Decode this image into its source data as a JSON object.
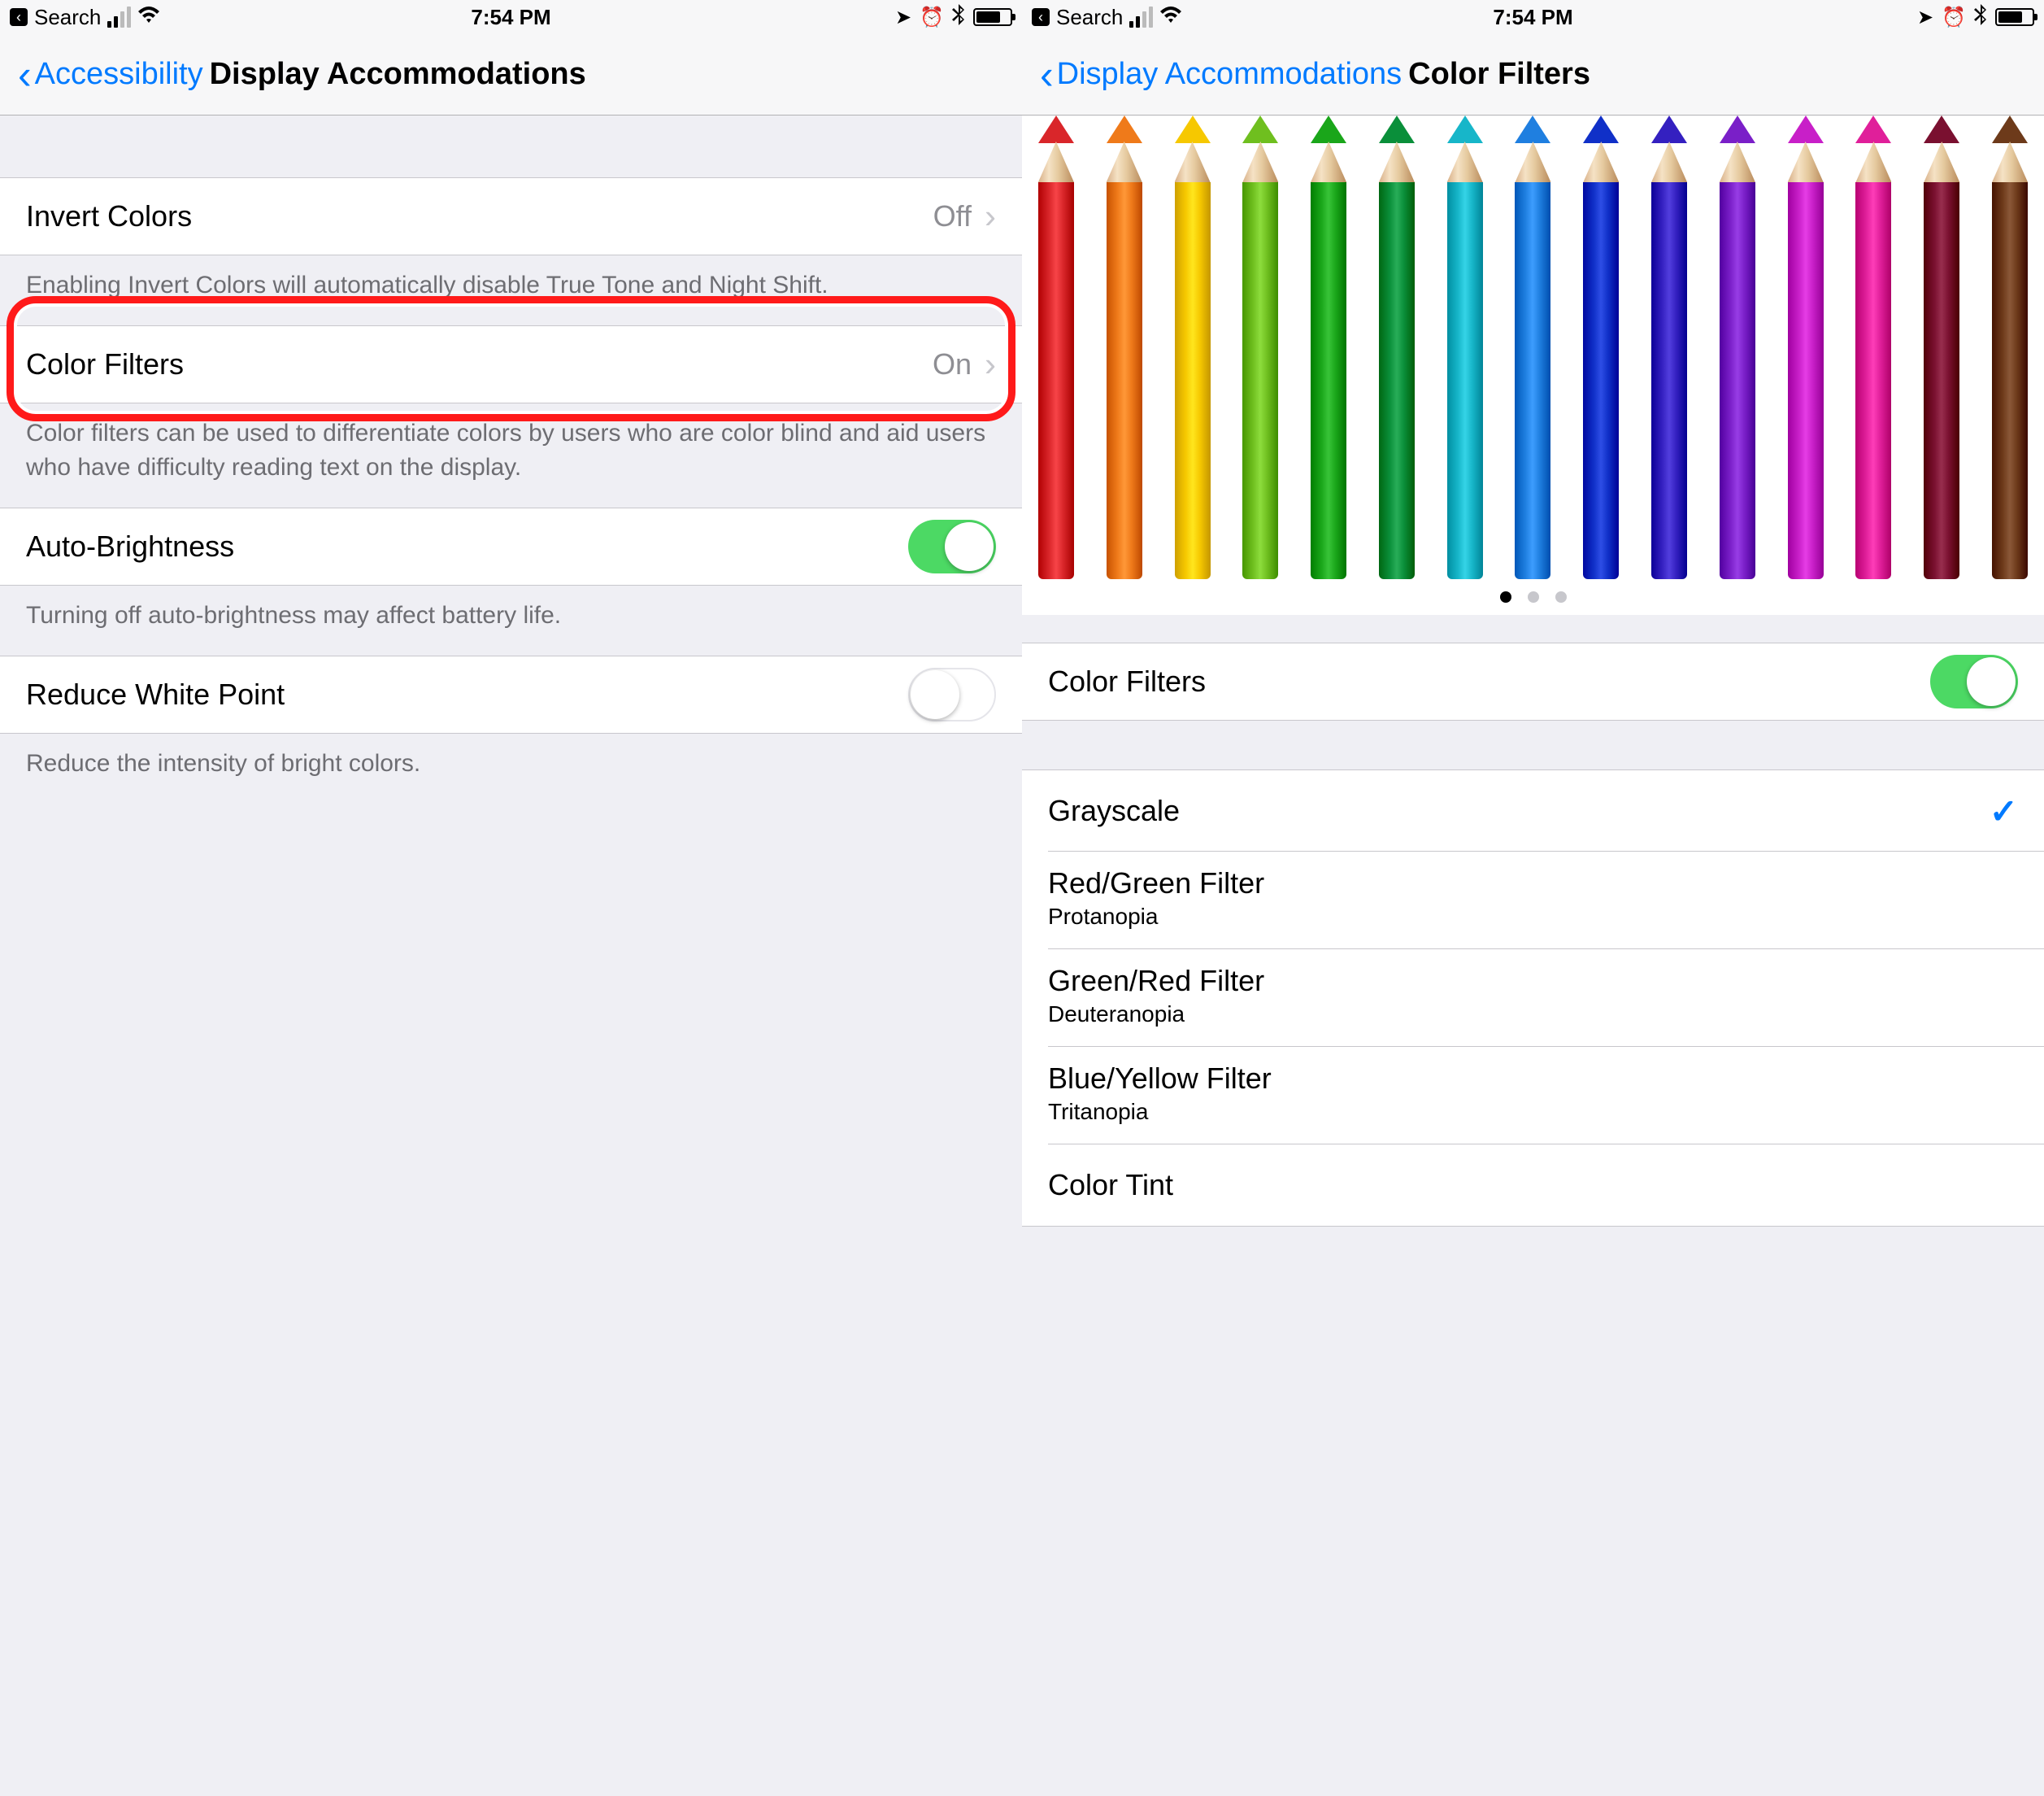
{
  "statusbar": {
    "back_label": "Search",
    "time": "7:54 PM"
  },
  "left": {
    "nav_back": "Accessibility",
    "nav_title": "Display Accommodations",
    "invert": {
      "label": "Invert Colors",
      "value": "Off"
    },
    "invert_note": "Enabling Invert Colors will automatically disable True Tone and Night Shift.",
    "color_filters": {
      "label": "Color Filters",
      "value": "On"
    },
    "color_filters_note": "Color filters can be used to differentiate colors by users who are color blind and aid users who have difficulty reading text on the display.",
    "auto_brightness": {
      "label": "Auto-Brightness"
    },
    "auto_brightness_note": "Turning off auto-brightness may affect battery life.",
    "reduce_white": {
      "label": "Reduce White Point"
    },
    "reduce_white_note": "Reduce the intensity of bright colors."
  },
  "right": {
    "nav_back": "Display Accommodations",
    "nav_title": "Color Filters",
    "toggle_label": "Color Filters",
    "options": [
      {
        "label": "Grayscale",
        "sub": "",
        "selected": true
      },
      {
        "label": "Red/Green Filter",
        "sub": "Protanopia",
        "selected": false
      },
      {
        "label": "Green/Red Filter",
        "sub": "Deuteranopia",
        "selected": false
      },
      {
        "label": "Blue/Yellow Filter",
        "sub": "Tritanopia",
        "selected": false
      },
      {
        "label": "Color Tint",
        "sub": "",
        "selected": false
      }
    ],
    "pencil_colors": [
      "#d9262a",
      "#ef7a1a",
      "#f6c800",
      "#6fbf1f",
      "#1aa61a",
      "#0a8f3a",
      "#17b6c9",
      "#1f7fe0",
      "#1030c8",
      "#3420c0",
      "#7a1fc8",
      "#c81fc8",
      "#e01f9a",
      "#7a1030",
      "#6d3a1a"
    ]
  }
}
